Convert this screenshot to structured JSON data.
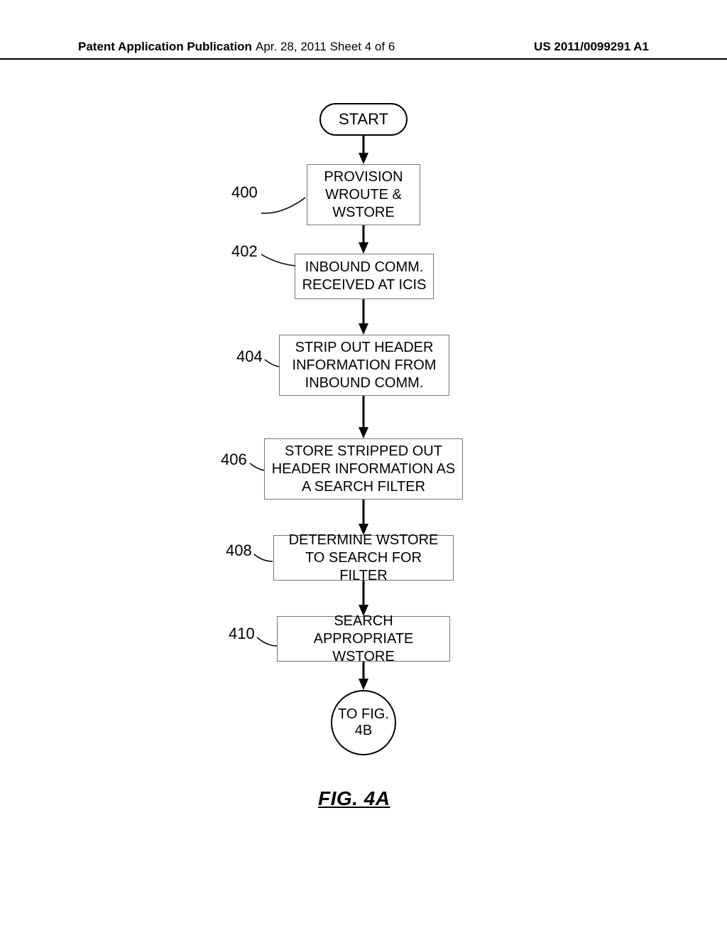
{
  "header": {
    "left": "Patent Application Publication",
    "center": "Apr. 28, 2011   Sheet 4 of 6",
    "right": "US 2011/0099291 A1"
  },
  "flowchart": {
    "start": "START",
    "steps": [
      {
        "ref": "400",
        "text": "PROVISION WROUTE & WSTORE"
      },
      {
        "ref": "402",
        "text": "INBOUND COMM. RECEIVED AT ICIS"
      },
      {
        "ref": "404",
        "text": "STRIP OUT HEADER INFORMATION FROM INBOUND COMM."
      },
      {
        "ref": "406",
        "text": "STORE STRIPPED OUT HEADER INFORMATION AS A SEARCH FILTER"
      },
      {
        "ref": "408",
        "text": "DETERMINE WSTORE TO SEARCH FOR FILTER"
      },
      {
        "ref": "410",
        "text": "SEARCH APPROPRIATE WSTORE"
      }
    ],
    "connector": "TO FIG. 4B",
    "caption": "FIG. 4A"
  }
}
